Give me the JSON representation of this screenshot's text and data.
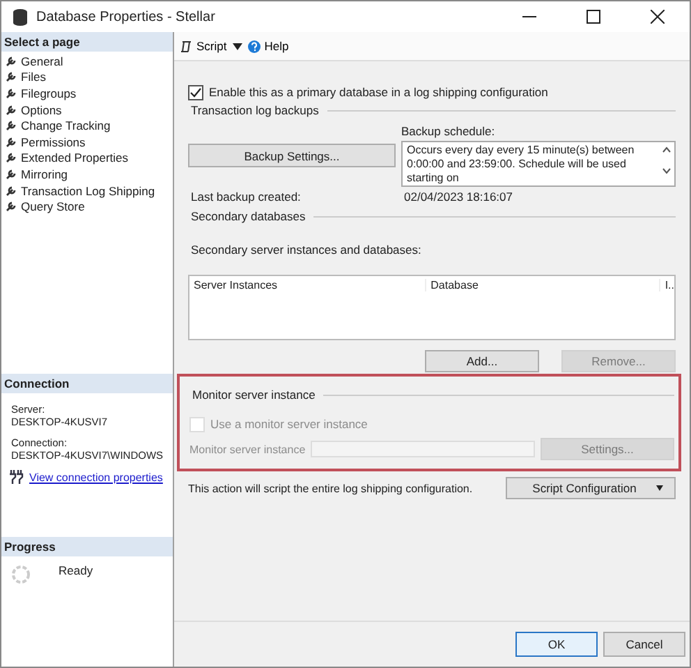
{
  "window": {
    "title": "Database Properties - Stellar"
  },
  "sidebar": {
    "header": "Select a page",
    "pages": [
      "General",
      "Files",
      "Filegroups",
      "Options",
      "Change Tracking",
      "Permissions",
      "Extended Properties",
      "Mirroring",
      "Transaction Log Shipping",
      "Query Store"
    ]
  },
  "connection": {
    "header": "Connection",
    "server_label": "Server:",
    "server": "DESKTOP-4KUSVI7",
    "connection_label": "Connection:",
    "connection": "DESKTOP-4KUSVI7\\WINDOWS",
    "link": "View connection properties"
  },
  "progress": {
    "header": "Progress",
    "status": "Ready"
  },
  "toolbar": {
    "script": "Script",
    "help": "Help"
  },
  "primary": {
    "label": "Enable this as a primary database in a log shipping configuration",
    "checked": true
  },
  "transaction_log_backups": {
    "title": "Transaction log backups",
    "schedule_label": "Backup schedule:",
    "settings_button": "Backup Settings...",
    "schedule": "Occurs every day every 15 minute(s) between 0:00:00 and 23:59:00. Schedule will be used starting on",
    "last_backup_label": "Last backup created:",
    "last_backup": "02/04/2023 18:16:07"
  },
  "secondary_databases": {
    "title": "Secondary databases",
    "list_label": "Secondary server instances and databases:",
    "columns": [
      "Server Instances",
      "Database",
      "I.."
    ],
    "buttons": [
      {
        "label": "Add...",
        "disabled": false
      },
      {
        "label": "Remove...",
        "disabled": true
      }
    ]
  },
  "monitor": {
    "title": "Monitor server instance",
    "use_label": "Use a monitor server instance",
    "use_checked": false,
    "disabled": true,
    "instance_label": "Monitor server instance",
    "settings_button": "Settings..."
  },
  "script_note": "This action will script the entire log shipping configuration.",
  "script_button": "Script Configuration",
  "buttons": [
    {
      "label": "OK",
      "default": true
    },
    {
      "label": "Cancel",
      "default": false
    }
  ]
}
